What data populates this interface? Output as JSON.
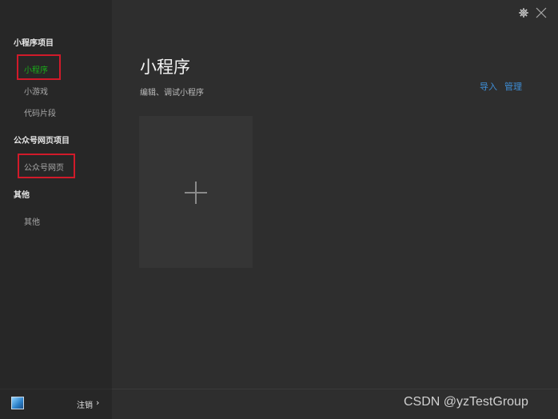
{
  "sidebar": {
    "groups": [
      {
        "title": "小程序项目",
        "items": [
          {
            "label": "小程序"
          },
          {
            "label": "小游戏"
          },
          {
            "label": "代码片段"
          }
        ]
      },
      {
        "title": "公众号网页项目",
        "items": [
          {
            "label": "公众号网页"
          }
        ]
      },
      {
        "title": "其他",
        "items": [
          {
            "label": "其他"
          }
        ]
      }
    ],
    "footer": {
      "logout_label": "注销",
      "arrow": "›"
    }
  },
  "main": {
    "title": "小程序",
    "subtitle": "编辑、调试小程序",
    "actions": {
      "import_label": "导入",
      "manage_label": "管理"
    }
  },
  "window": {
    "settings_icon": "gear-icon",
    "close_icon": "close-icon"
  },
  "watermark": "CSDN @yzTestGroup",
  "colors": {
    "accent": "#1aad19",
    "link": "#3f8fd8",
    "highlight": "#d11a2a"
  }
}
